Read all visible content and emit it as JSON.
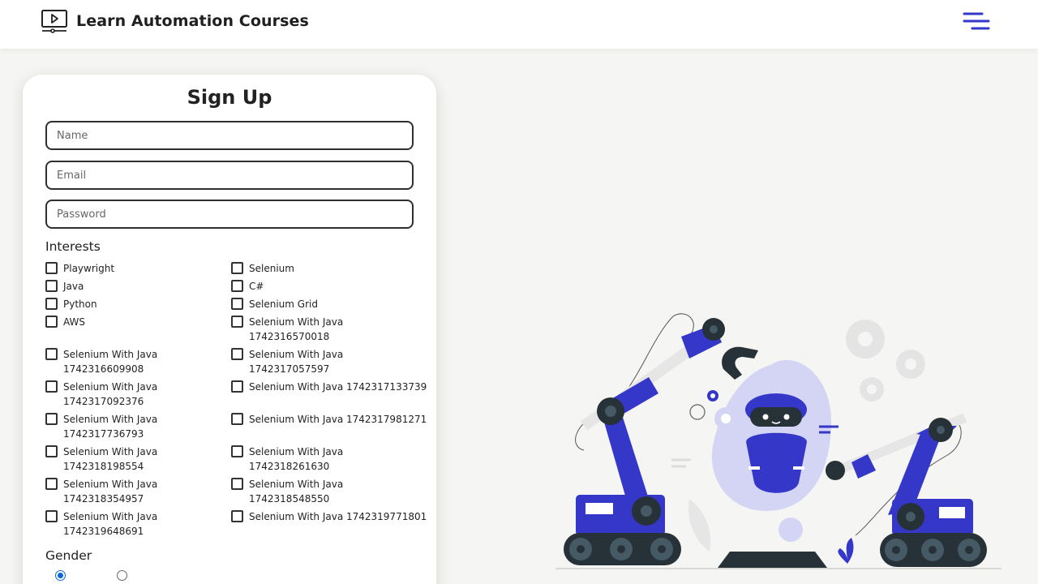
{
  "brand": {
    "title": "Learn Automation Courses",
    "icon": "video-play-monitor-icon"
  },
  "menu": {
    "icon": "hamburger-menu-icon"
  },
  "signup": {
    "title": "Sign Up",
    "name_placeholder": "Name",
    "email_placeholder": "Email",
    "password_placeholder": "Password",
    "interests_label": "Interests",
    "interests": [
      [
        "Playwright",
        ""
      ],
      [
        "Selenium",
        ""
      ],
      [
        "Java",
        ""
      ],
      [
        "C#",
        ""
      ],
      [
        "Python",
        ""
      ],
      [
        "Selenium Grid",
        ""
      ],
      [
        "AWS",
        ""
      ],
      [
        "Selenium With Java",
        "1742316570018"
      ],
      [
        "Selenium With Java",
        "1742316609908"
      ],
      [
        "Selenium With Java",
        "1742317057597"
      ],
      [
        "Selenium With Java",
        "1742317092376"
      ],
      [
        "Selenium With Java 1742317133739",
        ""
      ],
      [
        "Selenium With Java",
        "1742317736793"
      ],
      [
        "Selenium With Java 1742317981271",
        ""
      ],
      [
        "Selenium With Java",
        "1742318198554"
      ],
      [
        "Selenium With Java",
        "1742318261630"
      ],
      [
        "Selenium With Java",
        "1742318354957"
      ],
      [
        "Selenium With Java",
        "1742318548550"
      ],
      [
        "Selenium With Java",
        "1742319648691"
      ],
      [
        "Selenium With Java 1742319771801",
        ""
      ]
    ],
    "gender_label": "Gender",
    "gender_selected_index": 0
  },
  "colors": {
    "accent": "#3437c8",
    "robot_light": "#d4d5f5",
    "dark": "#263238",
    "radio": "#0a66d8"
  },
  "illustration": "robot-arms-illustration"
}
